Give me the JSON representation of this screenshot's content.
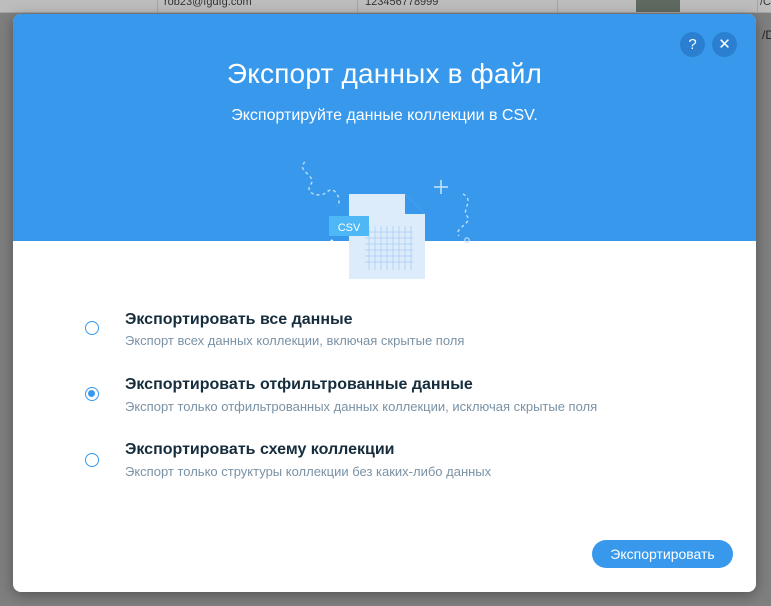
{
  "background": {
    "row_email": "rob23@fgdfg.com",
    "row_phone": "123456778999",
    "row_tail": "/C",
    "side_text": "/D"
  },
  "modal": {
    "title": "Экспорт данных в файл",
    "subtitle": "Экспортируйте данные коллекции в CSV.",
    "help_icon": "?",
    "close_icon": "✕",
    "illustration": {
      "badge": "CSV"
    },
    "options": [
      {
        "title": "Экспортировать все данные",
        "description": "Экспорт всех данных коллекции, включая скрытые поля",
        "selected": false
      },
      {
        "title": "Экспортировать отфильтрованные данные",
        "description": "Экспорт только отфильтрованных данных коллекции, исключая скрытые поля",
        "selected": true
      },
      {
        "title": "Экспортировать схему коллекции",
        "description": "Экспорт только структуры коллекции без каких-либо данных",
        "selected": false
      }
    ],
    "export_button": "Экспортировать"
  },
  "colors": {
    "accent": "#3899ec",
    "title_text": "#162d3d",
    "secondary_text": "#7a92a5"
  }
}
